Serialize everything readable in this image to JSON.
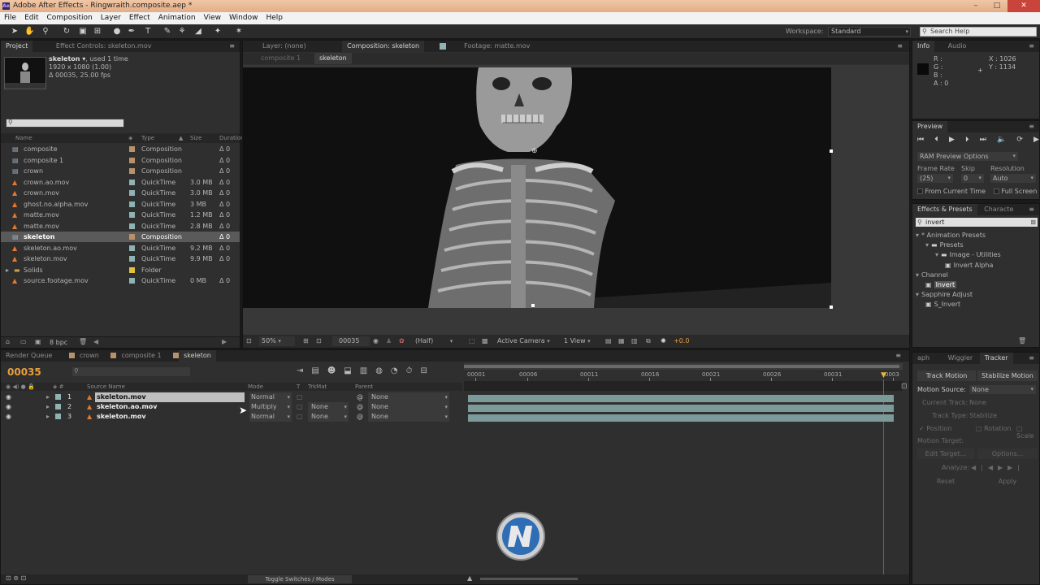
{
  "window": {
    "title": "Adobe After Effects - Ringwraith.composite.aep *",
    "app_icon_text": "Ae",
    "controls": [
      "–",
      "□",
      "✕"
    ]
  },
  "menu": [
    "File",
    "Edit",
    "Composition",
    "Layer",
    "Effect",
    "Animation",
    "View",
    "Window",
    "Help"
  ],
  "toolbar": {
    "workspace_label": "Workspace:",
    "workspace_value": "Standard",
    "search_placeholder": "Search Help"
  },
  "project": {
    "tabs": [
      "Project",
      "Effect Controls: skeleton.mov"
    ],
    "selected_name": "skeleton ▾",
    "used": ", used 1 time",
    "dims": "1920 x 1080 (1.00)",
    "duration": "Δ 00035, 25.00 fps",
    "search_placeholder": "",
    "columns": {
      "name": "Name",
      "type": "Type",
      "size": "Size",
      "duration": "Duration"
    },
    "items": [
      {
        "name": "composite",
        "type": "Composition",
        "size": "",
        "dur": "Δ 0",
        "color": "#b9926a",
        "icon": "comp"
      },
      {
        "name": "composite 1",
        "type": "Composition",
        "size": "",
        "dur": "Δ 0",
        "color": "#b9926a",
        "icon": "comp"
      },
      {
        "name": "crown",
        "type": "Composition",
        "size": "",
        "dur": "Δ 0",
        "color": "#b9926a",
        "icon": "comp"
      },
      {
        "name": "crown.ao.mov",
        "type": "QuickTime",
        "size": "3.0 MB",
        "dur": "Δ 0",
        "color": "#8fb3b3",
        "icon": "mov"
      },
      {
        "name": "crown.mov",
        "type": "QuickTime",
        "size": "3.0 MB",
        "dur": "Δ 0",
        "color": "#8fb3b3",
        "icon": "mov"
      },
      {
        "name": "ghost.no.alpha.mov",
        "type": "QuickTime",
        "size": "3 MB",
        "dur": "Δ 0",
        "color": "#8fb3b3",
        "icon": "mov"
      },
      {
        "name": "matte.mov",
        "type": "QuickTime",
        "size": "1.2 MB",
        "dur": "Δ 0",
        "color": "#8fb3b3",
        "icon": "mov"
      },
      {
        "name": "matte.mov",
        "type": "QuickTime",
        "size": "2.8 MB",
        "dur": "Δ 0",
        "color": "#8fb3b3",
        "icon": "mov"
      },
      {
        "name": "skeleton",
        "type": "Composition",
        "size": "",
        "dur": "Δ 0",
        "color": "#b9926a",
        "icon": "comp",
        "selected": true
      },
      {
        "name": "skeleton.ao.mov",
        "type": "QuickTime",
        "size": "9.2 MB",
        "dur": "Δ 0",
        "color": "#8fb3b3",
        "icon": "mov"
      },
      {
        "name": "skeleton.mov",
        "type": "QuickTime",
        "size": "9.9 MB",
        "dur": "Δ 0",
        "color": "#8fb3b3",
        "icon": "mov"
      },
      {
        "name": "Solids",
        "type": "Folder",
        "size": "",
        "dur": "",
        "color": "#e5c13a",
        "icon": "folder"
      },
      {
        "name": "source.footage.mov",
        "type": "QuickTime",
        "size": "0 MB",
        "dur": "Δ 0",
        "color": "#8fb3b3",
        "icon": "mov"
      }
    ],
    "bpc": "8 bpc"
  },
  "viewer": {
    "tabs": [
      "Layer: (none)",
      "Composition: skeleton",
      "Footage: matte.mov"
    ],
    "subtabs": [
      "composite 1",
      "skeleton"
    ],
    "zoom": "50%",
    "timecode": "00035",
    "resolution": "(Half)",
    "camera": "Active Camera",
    "views": "1 View",
    "exposure": "+0.0"
  },
  "info": {
    "tabs": [
      "Info",
      "Audio"
    ],
    "channels": [
      "R :",
      "G :",
      "B :",
      "A : 0"
    ],
    "x": "X : 1026",
    "y": "Y : 1134"
  },
  "preview": {
    "title": "Preview",
    "ram_options": "RAM Preview Options",
    "frame_rate_label": "Frame Rate",
    "skip_label": "Skip",
    "resolution_label": "Resolution",
    "frame_rate": "(25)",
    "skip": "0",
    "resolution": "Auto",
    "from_current": "From Current Time",
    "full_screen": "Full Screen"
  },
  "effects": {
    "tabs": [
      "Effects & Presets",
      "Characte"
    ],
    "search": "invert",
    "tree": [
      {
        "label": "* Animation Presets",
        "indent": 0,
        "arrow": "▾"
      },
      {
        "label": "Presets",
        "indent": 1,
        "arrow": "▾",
        "folder": true
      },
      {
        "label": "Image - Utilities",
        "indent": 2,
        "arrow": "▾",
        "folder": true
      },
      {
        "label": "Invert Alpha",
        "indent": 3,
        "arrow": "",
        "preset": true
      },
      {
        "label": "Channel",
        "indent": 0,
        "arrow": "▾"
      },
      {
        "label": "Invert",
        "indent": 1,
        "arrow": "",
        "effect": true,
        "selected": true
      },
      {
        "label": "Sapphire Adjust",
        "indent": 0,
        "arrow": "▾"
      },
      {
        "label": "S_Invert",
        "indent": 1,
        "arrow": "",
        "effect": true
      }
    ]
  },
  "tracker": {
    "tabs": [
      "aph",
      "Wiggler",
      "Tracker"
    ],
    "track_motion": "Track Motion",
    "stabilize_motion": "Stabilize Motion",
    "motion_source_label": "Motion Source:",
    "motion_source": "None",
    "current_track_label": "Current Track:",
    "current_track": "None",
    "track_type_label": "Track Type:",
    "track_type": "Stabilize",
    "position": "Position",
    "rotation": "Rotation",
    "scale": "Scale",
    "motion_target": "Motion Target:",
    "edit_target": "Edit Target...",
    "options": "Options...",
    "analyze": "Analyze:",
    "reset": "Reset",
    "apply": "Apply"
  },
  "timeline": {
    "tabs": [
      "Render Queue",
      "crown",
      "composite 1",
      "skeleton"
    ],
    "timecode": "00035",
    "columns": {
      "source": "Source Name",
      "mode": "Mode",
      "t": "T",
      "trkmat": "TrkMat",
      "parent": "Parent"
    },
    "layers": [
      {
        "num": "1",
        "name": "skeleton.mov",
        "mode": "Normal",
        "trkmat": "",
        "parent": "None",
        "selected": true
      },
      {
        "num": "2",
        "name": "skeleton.ao.mov",
        "mode": "Multiply",
        "trkmat": "None",
        "parent": "None"
      },
      {
        "num": "3",
        "name": "skeleton.mov",
        "mode": "Normal",
        "trkmat": "None",
        "parent": "None"
      }
    ],
    "ruler": [
      "00001",
      "00006",
      "00011",
      "00016",
      "00021",
      "00026",
      "00031",
      "0003"
    ],
    "toggle": "Toggle Switches / Modes"
  },
  "colors": {
    "accent": "#e89f3d",
    "track": "#7d9a9a",
    "selected": "#5a5a5a",
    "current_time_line": "#d33"
  },
  "icons": [
    "selection-tool-icon",
    "hand-tool-icon",
    "zoom-tool-icon",
    "rotate-tool-icon",
    "camera-tool-icon",
    "pan-behind-icon",
    "ellipse-tool-icon",
    "pen-tool-icon",
    "text-tool-icon",
    "brush-tool-icon",
    "clone-stamp-icon",
    "eraser-icon",
    "roto-brush-icon",
    "puppet-pin-icon"
  ]
}
